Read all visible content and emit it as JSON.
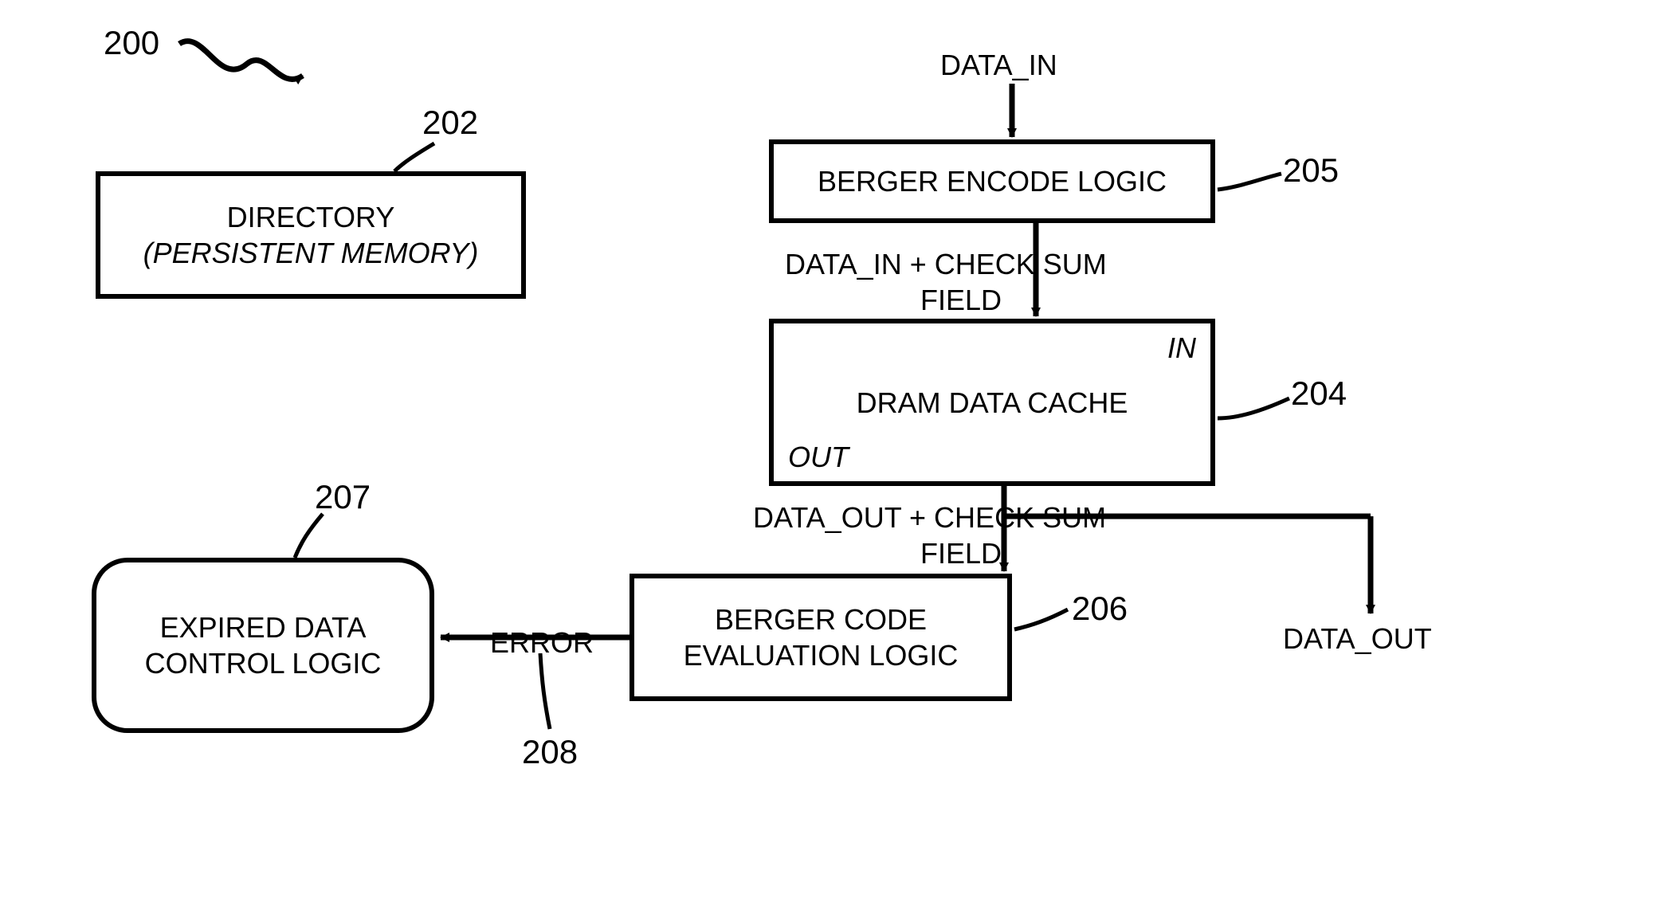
{
  "refs": {
    "r200": "200",
    "r202": "202",
    "r205": "205",
    "r204": "204",
    "r206": "206",
    "r207": "207",
    "r208": "208"
  },
  "blocks": {
    "directory_line1": "DIRECTORY",
    "directory_line2": "(PERSISTENT MEMORY)",
    "encode": "BERGER ENCODE LOGIC",
    "cache_in": "IN",
    "cache_main": "DRAM DATA CACHE",
    "cache_out": "OUT",
    "eval_line1": "BERGER CODE",
    "eval_line2": "EVALUATION LOGIC",
    "expired_line1": "EXPIRED DATA",
    "expired_line2": "CONTROL LOGIC"
  },
  "signals": {
    "data_in": "DATA_IN",
    "encode_out_line1": "DATA_IN + CHECK SUM",
    "encode_out_line2": "FIELD",
    "cache_out_line1": "DATA_OUT + CHECK SUM",
    "cache_out_line2": "FIELD",
    "data_out": "DATA_OUT",
    "error": "ERROR"
  }
}
